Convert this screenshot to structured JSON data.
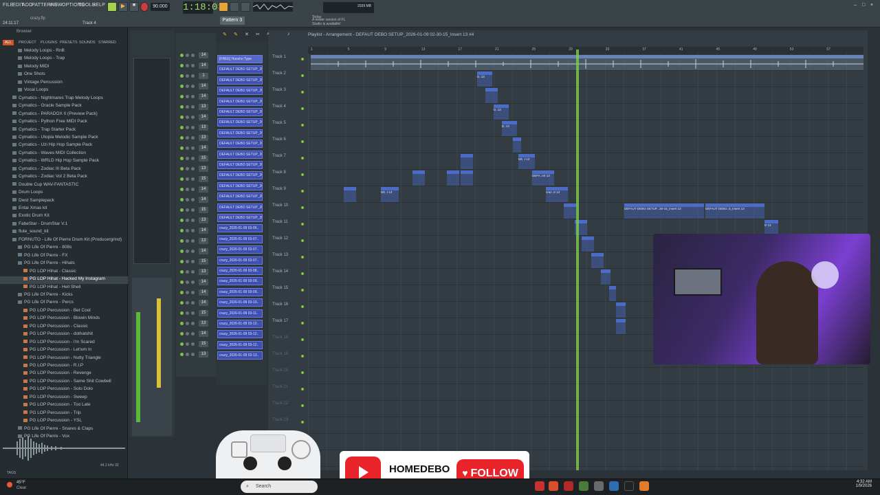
{
  "topbar": {
    "menu": [
      "FILE",
      "EDIT",
      "ADD",
      "PATTERNS",
      "VIEW",
      "OPTIONS",
      "TOOLS",
      "HELP"
    ],
    "time": "1:18:03",
    "bpm": "90.000",
    "pattern": "Pattern 3",
    "project": "crazy.flp",
    "track_hint": "Track 4",
    "cpu": "2039 MB",
    "notice_today": "Today",
    "notice": "A newer version of FL Studio is available!",
    "time_left": "24:11:17"
  },
  "browser": {
    "label": "Browser",
    "tabs": [
      "ALL",
      "PROJECT",
      "PLUGINS",
      "PRESETS",
      "SOUNDS",
      "STARRED"
    ],
    "items": [
      {
        "label": "Melody Loops - RnB",
        "indent": 1
      },
      {
        "label": "Melody Loops - Trap",
        "indent": 1
      },
      {
        "label": "Melody MIDI",
        "indent": 1
      },
      {
        "label": "One Shots",
        "indent": 1
      },
      {
        "label": "Vintage Percussion",
        "indent": 1
      },
      {
        "label": "Vocal Loops",
        "indent": 1
      },
      {
        "label": "Cymatics - Nightmares Trap Melody Loops",
        "indent": 0
      },
      {
        "label": "Cymatics - Oracle Sample Pack",
        "indent": 0
      },
      {
        "label": "Cymatics - PARADOX II (Preview Pack)",
        "indent": 0
      },
      {
        "label": "Cymatics - Python Free MIDI Pack",
        "indent": 0
      },
      {
        "label": "Cymatics - Trap Starter Pack",
        "indent": 0
      },
      {
        "label": "Cymatics - Utopia Melodic Sample Pack",
        "indent": 0
      },
      {
        "label": "Cymatics - Uzi Hip Hop Sample Pack",
        "indent": 0
      },
      {
        "label": "Cymatics - Waves MIDI Collection",
        "indent": 0
      },
      {
        "label": "Cymatics - WRLD Hip Hop Sample Pack",
        "indent": 0
      },
      {
        "label": "Cymatics - Zodiac III Beta Pack",
        "indent": 0
      },
      {
        "label": "Cymatics - Zodiac Vol 2 Beta Pack",
        "indent": 0
      },
      {
        "label": "Double Cup WAV-FANTASTIC",
        "indent": 0
      },
      {
        "label": "Drum Loops",
        "indent": 0
      },
      {
        "label": "Dwst Samplepack",
        "indent": 0
      },
      {
        "label": "Entai Xmas kit",
        "indent": 0
      },
      {
        "label": "Exotic Drum Kit",
        "indent": 0
      },
      {
        "label": "FabeStar - DrumStar V.1",
        "indent": 0
      },
      {
        "label": "flute_sound_kit",
        "indent": 0
      },
      {
        "label": "FORNUTO - Life Of Pierre Drum Kit (Producergrind)",
        "indent": 0
      },
      {
        "label": "PG Life Of Pierre - 808s",
        "indent": 1
      },
      {
        "label": "PG Life Of Pierre - FX",
        "indent": 1
      },
      {
        "label": "PG Life Of Pierre - Hihats",
        "indent": 1
      },
      {
        "label": "PG LOP Hihat - Classic",
        "indent": 2
      },
      {
        "label": "PG LOP Hihat - Hacked My Instagram",
        "indent": 2,
        "selected": true
      },
      {
        "label": "PG LOP Hihat - Hell Shell",
        "indent": 2
      },
      {
        "label": "PG Life Of Pierre - Kicks",
        "indent": 1
      },
      {
        "label": "PG Life Of Pierre - Percs",
        "indent": 1
      },
      {
        "label": "PG LOP Percussion - Bet Cool",
        "indent": 2
      },
      {
        "label": "PG LOP Percussion - Blowin Minds",
        "indent": 2
      },
      {
        "label": "PG LOP Percussion - Classic",
        "indent": 2
      },
      {
        "label": "PG LOP Percussion - dothatshit",
        "indent": 2
      },
      {
        "label": "PG LOP Percussion - I'm Scared",
        "indent": 2
      },
      {
        "label": "PG LOP Percussion - Let'em In",
        "indent": 2
      },
      {
        "label": "PG LOP Percussion - Nutty Triangle",
        "indent": 2
      },
      {
        "label": "PG LOP Percussion - R.I.P",
        "indent": 2
      },
      {
        "label": "PG LOP Percussion - Revenge",
        "indent": 2
      },
      {
        "label": "PG LOP Percussion - Same Shit Cowbell",
        "indent": 2
      },
      {
        "label": "PG LOP Percussion - Solo Dolo",
        "indent": 2
      },
      {
        "label": "PG LOP Percussion - Sweep",
        "indent": 2
      },
      {
        "label": "PG LOP Percussion - Too Late",
        "indent": 2
      },
      {
        "label": "PG LOP Percussion - Trip",
        "indent": 2
      },
      {
        "label": "PG LOP Percussion - YSL",
        "indent": 2
      },
      {
        "label": "PG Life Of Pierre - Snares & Claps",
        "indent": 1
      },
      {
        "label": "PG Life Of Pierre - Vox",
        "indent": 1
      }
    ],
    "tags": "TAGS",
    "sample_rate": "44.1 kHz 32"
  },
  "channels": [
    "14",
    "14",
    "1",
    "14",
    "14",
    "13",
    "14",
    "13",
    "13",
    "14",
    "15",
    "13",
    "15",
    "14",
    "14",
    "15",
    "13",
    "14",
    "13",
    "14",
    "15",
    "13",
    "14",
    "14",
    "14",
    "15",
    "13",
    "14",
    "15",
    "13"
  ],
  "patterns": [
    "[FREE] Hunxho Type",
    "DEFAULT DEBO SETUP_202..",
    "DEFAULT DEBO SETUP_202..",
    "DEFAULT DEBO SETUP_202..",
    "DEFAULT DEBO SETUP_202..",
    "DEFAULT DEBO SETUP_202..",
    "DEFAULT DEBO SETUP_202..",
    "DEFAULT DEBO SETUP_202..",
    "DEFAULT DEBO SETUP_202..",
    "DEFAULT DEBO SETUP_202..",
    "DEFAULT DEBO SETUP_202..",
    "DEFAULT DEBO SETUP_202..",
    "DEFAULT DEBO SETUP_202..",
    "DEFAULT DEBO SETUP_202..",
    "DEFAULT DEBO SETUP_202..",
    "DEFAULT DEBO SETUP_202..",
    "crazy_2026-01-09 03-06..",
    "crazy_2026-01-09 03-07..",
    "crazy_2026-01-09 03-07..",
    "crazy_2026-01-09 03-07..",
    "crazy_2026-01-09 03-08..",
    "crazy_2026-01-09 03-09..",
    "crazy_2026-01-09 03-09..",
    "crazy_2026-01-09 03-10..",
    "crazy_2026-01-09 03-11..",
    "crazy_2026-01-09 03-12..",
    "crazy_2026-01-09 03-12..",
    "crazy_2026-01-09 03-12..",
    "crazy_2026-01-09 03-13.."
  ],
  "playlist": {
    "title": "Playlist - Arrangement - DEFAUT DEBO SETUP_2026-01-09 02-30-15_Insert 13 #4",
    "ruler": [
      "1",
      "5",
      "9",
      "13",
      "17",
      "21",
      "25",
      "29",
      "33",
      "37",
      "41",
      "45",
      "49",
      "53",
      "57"
    ],
    "tracks": [
      "Track 1",
      "Track 2",
      "Track 3",
      "Track 4",
      "Track 5",
      "Track 6",
      "Track 7",
      "Track 8",
      "Track 9",
      "Track 10",
      "Track 11",
      "Track 12",
      "Track 13",
      "Track 14",
      "Track 15",
      "Track 16",
      "Track 17",
      "Track 18",
      "Track 19",
      "Track 20",
      "Track 21",
      "Track 22",
      "Track 23"
    ],
    "clip_audio": "[FREE] Hunxho Type Beat - Some Crazy Story",
    "clip_a": "D..13",
    "clip_b": "DE..t 13",
    "clip_c": "DEFA..ert 13",
    "clip_d": "craz..rt 13",
    "clip_long1": "DEFAUT DEBO SETUP...30-15_Insert 13",
    "clip_long2": "DEFAUT DEBO..5_Insert 13",
    "clip_small": "D 13"
  },
  "overlay": {
    "channel": "HOMEDEBO",
    "follow": "FOLLOW"
  },
  "taskbar": {
    "weather_temp": "45°F",
    "weather_desc": "Clear",
    "search": "Search",
    "clock": "4:32 AM",
    "date": "1/9/2026"
  },
  "colors": {
    "pattern_blue": "#3f4fb0",
    "playhead": "#7fd04a",
    "youtube_red": "#e8232a",
    "time_green": "#9fe06a"
  }
}
